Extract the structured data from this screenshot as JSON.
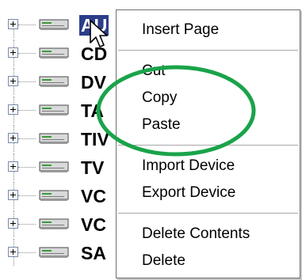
{
  "tree": {
    "items": [
      {
        "label": "AU",
        "selected": true
      },
      {
        "label": "CD"
      },
      {
        "label": "DV"
      },
      {
        "label": "TA"
      },
      {
        "label": "TIV"
      },
      {
        "label": "TV"
      },
      {
        "label": "VC"
      },
      {
        "label": "VC"
      },
      {
        "label": "SA"
      }
    ],
    "selection_color": "#2c3e8a"
  },
  "context_menu": {
    "insert_page": "Insert Page",
    "cut": "Cut",
    "copy": "Copy",
    "paste": "Paste",
    "import_device": "Import Device",
    "export_device": "Export Device",
    "delete_contents": "Delete Contents",
    "delete": "Delete"
  },
  "annotation": {
    "shape": "ellipse",
    "color": "#1aa34a"
  },
  "icons": {
    "expander": "plus-box-icon",
    "device": "device-icon",
    "cursor": "mouse-pointer-icon"
  }
}
